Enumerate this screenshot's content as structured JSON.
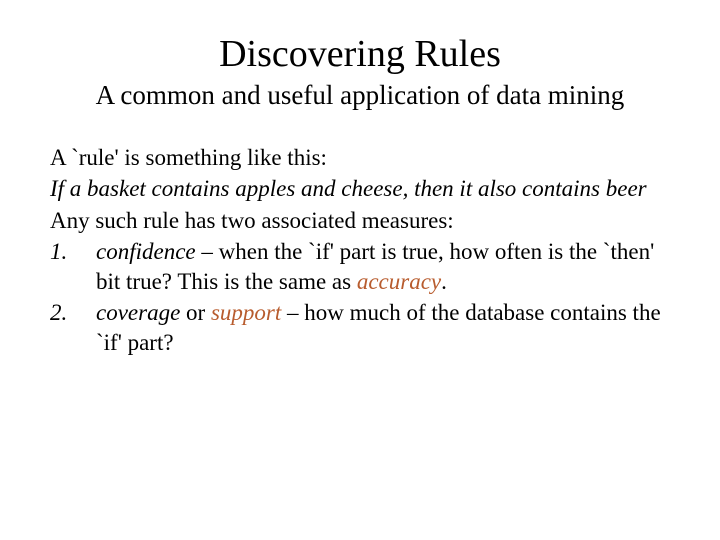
{
  "title": "Discovering Rules",
  "subtitle": "A common and useful application of data mining",
  "intro": "A `rule' is something like this:",
  "example": "If a basket contains apples and cheese, then it also contains beer",
  "measures_intro": "Any such rule has two associated measures:",
  "items": [
    {
      "num": "1.",
      "keyword": "confidence",
      "rest1": " – when the `if' part is true, how often is the `then' bit true? This is the same as ",
      "highlight": "accuracy",
      "rest2": "."
    },
    {
      "num": "2.",
      "keyword": "coverage",
      "rest1": "  or ",
      "highlight": "support",
      "rest2": " – how much of the database contains the `if' part?"
    }
  ]
}
